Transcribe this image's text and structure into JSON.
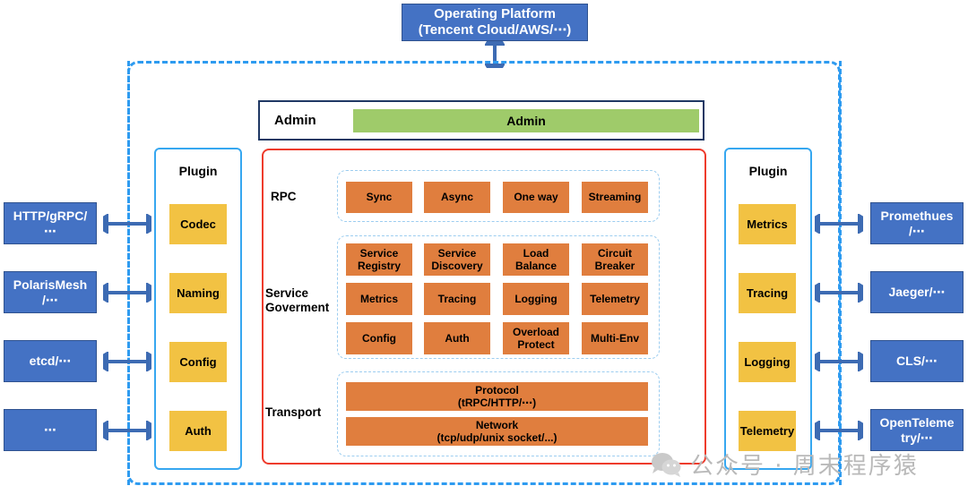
{
  "diagram": {
    "title": "tRPC Framework Architecture",
    "colors": {
      "blue": "#4472C4",
      "yellow": "#F2C243",
      "orange": "#E07E3E",
      "green": "#9FCB6A",
      "red_border": "#EE3B2C",
      "light_blue_border": "#36A7F0",
      "dashed_blue": "#2E9BF0",
      "dark_navy_border": "#1F3864"
    }
  },
  "platform": {
    "line1": "Operating Platform",
    "line2": "(Tencent Cloud/AWS/⋯)"
  },
  "admin": {
    "row_label": "Admin",
    "bar_label": "Admin"
  },
  "plugin_left": {
    "title": "Plugin",
    "items": [
      {
        "label": "Codec"
      },
      {
        "label": "Naming"
      },
      {
        "label": "Config"
      },
      {
        "label": "Auth"
      }
    ]
  },
  "plugin_right": {
    "title": "Plugin",
    "items": [
      {
        "label": "Metrics"
      },
      {
        "label": "Tracing"
      },
      {
        "label": "Logging"
      },
      {
        "label": "Telemetry"
      }
    ]
  },
  "external_left": [
    {
      "line1": "HTTP/gRPC/",
      "line2": "⋯"
    },
    {
      "line1": "PolarisMesh",
      "line2": "/⋯"
    },
    {
      "line1": "etcd/⋯",
      "line2": ""
    },
    {
      "line1": "⋯",
      "line2": ""
    }
  ],
  "external_right": [
    {
      "line1": "Promethues",
      "line2": "/⋯"
    },
    {
      "line1": "Jaeger/⋯",
      "line2": ""
    },
    {
      "line1": "CLS/⋯",
      "line2": ""
    },
    {
      "line1": "OpenTeleme",
      "line2": "try/⋯"
    }
  ],
  "core": {
    "rpc": {
      "label": "RPC",
      "items": [
        {
          "line1": "Sync",
          "line2": ""
        },
        {
          "line1": "Async",
          "line2": ""
        },
        {
          "line1": "One way",
          "line2": ""
        },
        {
          "line1": "Streaming",
          "line2": ""
        }
      ]
    },
    "service_goverment": {
      "label_line1": "Service",
      "label_line2": "Goverment",
      "items": [
        {
          "line1": "Service",
          "line2": "Registry"
        },
        {
          "line1": "Service",
          "line2": "Discovery"
        },
        {
          "line1": "Load",
          "line2": "Balance"
        },
        {
          "line1": "Circuit",
          "line2": "Breaker"
        },
        {
          "line1": "Metrics",
          "line2": ""
        },
        {
          "line1": "Tracing",
          "line2": ""
        },
        {
          "line1": "Logging",
          "line2": ""
        },
        {
          "line1": "Telemetry",
          "line2": ""
        },
        {
          "line1": "Config",
          "line2": ""
        },
        {
          "line1": "Auth",
          "line2": ""
        },
        {
          "line1": "Overload",
          "line2": "Protect"
        },
        {
          "line1": "Multi-Env",
          "line2": ""
        }
      ]
    },
    "transport": {
      "label": "Transport",
      "items": [
        {
          "line1": "Protocol",
          "line2": "(tRPC/HTTP/⋯)"
        },
        {
          "line1": "Network",
          "line2": "(tcp/udp/unix socket/...)"
        }
      ]
    }
  },
  "watermark": {
    "text": "公众号 · 周末程序猿"
  }
}
